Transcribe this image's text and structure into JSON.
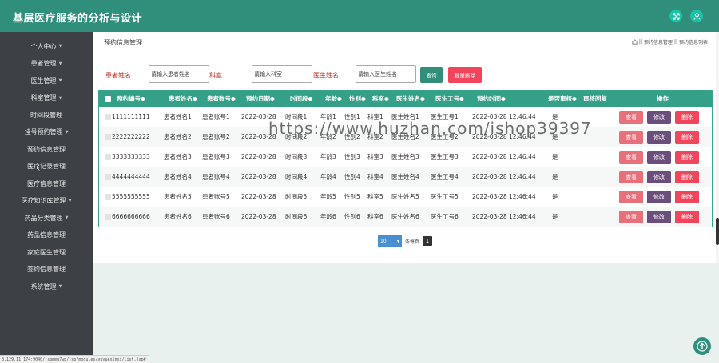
{
  "app": {
    "title": "基层医疗服务的分析与设计"
  },
  "header": {
    "icons": [
      "expand-icon",
      "user-icon"
    ],
    "bg": "#2f8f7b"
  },
  "sidebar": {
    "items": [
      {
        "label": "个人中心",
        "caret": true
      },
      {
        "label": "患者管理",
        "caret": true
      },
      {
        "label": "医生管理",
        "caret": true
      },
      {
        "label": "科室管理",
        "caret": true
      },
      {
        "label": "时间段管理",
        "caret": false
      },
      {
        "label": "挂号预约管理",
        "caret": true
      },
      {
        "label": "预约信息管理",
        "caret": false
      },
      {
        "label": "医疗记录管理",
        "caret": false
      },
      {
        "label": "医疗信息管理",
        "caret": false
      },
      {
        "label": "医疗知识库管理",
        "caret": true
      },
      {
        "label": "药品分类管理",
        "caret": true
      },
      {
        "label": "药品信息管理",
        "caret": false
      },
      {
        "label": "家庭医生管理",
        "caret": false
      },
      {
        "label": "签约信息管理",
        "caret": false
      },
      {
        "label": "系统管理",
        "caret": true
      }
    ]
  },
  "status_url": "8.129.11.174:9040/jspmmw7wp/jsp/modules/yuyuexinxi/list.jsp#",
  "page": {
    "title": "预约信息管理",
    "breadcrumb": [
      "预约信息管理",
      "预约信息列表"
    ]
  },
  "filters": {
    "patient_label": "患者姓名",
    "patient_placeholder": "请输入患者姓名",
    "dept_label": "科室",
    "dept_placeholder": "请输入科室",
    "doctor_label": "医生姓名",
    "doctor_placeholder": "请输入医生姓名",
    "search_label": "查询",
    "batch_delete_label": "批量删除"
  },
  "table": {
    "columns": [
      "预约编号◆",
      "患者姓名◆",
      "患者账号◆",
      "预约日期◆",
      "时间段◆",
      "年龄◆",
      "性别◆",
      "科室◆",
      "医生姓名◆",
      "医生工号◆",
      "预约时间◆",
      "是否审核◆",
      "审核回复",
      "操作"
    ],
    "rows": [
      [
        "1111111111",
        "患者姓名1",
        "患者账号1",
        "2022-03-28",
        "时间段1",
        "年龄1",
        "性别1",
        "科室1",
        "医生姓名1",
        "医生工号1",
        "2022-03-28 12:46:44",
        "是",
        ""
      ],
      [
        "2222222222",
        "患者姓名2",
        "患者账号2",
        "2022-03-28",
        "时间段2",
        "年龄2",
        "性别2",
        "科室2",
        "医生姓名2",
        "医生工号2",
        "2022-03-28 12:46:44",
        "是",
        ""
      ],
      [
        "3333333333",
        "患者姓名3",
        "患者账号3",
        "2022-03-28",
        "时间段3",
        "年龄3",
        "性别3",
        "科室3",
        "医生姓名3",
        "医生工号3",
        "2022-03-28 12:46:44",
        "是",
        ""
      ],
      [
        "4444444444",
        "患者姓名4",
        "患者账号4",
        "2022-03-28",
        "时间段4",
        "年龄4",
        "性别4",
        "科室4",
        "医生姓名4",
        "医生工号4",
        "2022-03-28 12:46:44",
        "是",
        ""
      ],
      [
        "5555555555",
        "患者姓名5",
        "患者账号5",
        "2022-03-28",
        "时间段5",
        "年龄5",
        "性别5",
        "科室5",
        "医生姓名5",
        "医生工号5",
        "2022-03-28 12:46:44",
        "是",
        ""
      ],
      [
        "6666666666",
        "患者姓名6",
        "患者账号6",
        "2022-03-28",
        "时间段6",
        "年龄6",
        "性别6",
        "科室6",
        "医生姓名6",
        "医生工号6",
        "2022-03-28 12:46:44",
        "是",
        ""
      ]
    ],
    "actions": {
      "view": "查看",
      "edit": "修改",
      "delete": "删除"
    }
  },
  "watermark": "https://www.huzhan.com/ishop39397",
  "pagination": {
    "page_size": "10",
    "per_page_label": "条每页",
    "current_page": "1"
  },
  "colors": {
    "accent": "#35a088",
    "search": "#2f8f7b",
    "danger": "#f0455a",
    "view": "#e8707a",
    "edit": "#6b4e7c",
    "sidebar": "#3d4146"
  }
}
